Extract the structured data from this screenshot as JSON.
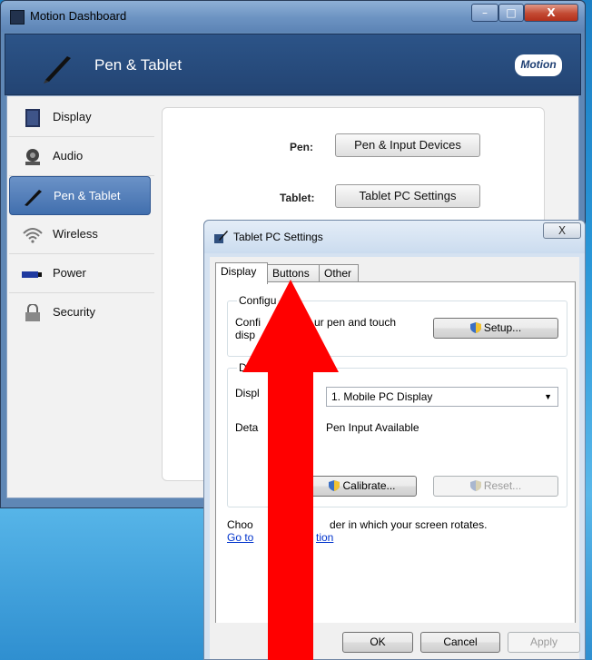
{
  "dashboard": {
    "window_title": "Motion Dashboard",
    "header_title": "Pen & Tablet",
    "logo_text": "Motion",
    "window_buttons": {
      "minimize": "–",
      "maximize": "□",
      "close": "X"
    },
    "nav": [
      {
        "label": "Display",
        "icon": "monitor-icon",
        "active": false
      },
      {
        "label": "Audio",
        "icon": "speaker-icon",
        "active": false
      },
      {
        "label": "Pen & Tablet",
        "icon": "pen-icon",
        "active": true
      },
      {
        "label": "Wireless",
        "icon": "wifi-icon",
        "active": false
      },
      {
        "label": "Power",
        "icon": "battery-icon",
        "active": false
      },
      {
        "label": "Security",
        "icon": "lock-icon",
        "active": false
      }
    ],
    "pen_label": "Pen:",
    "pen_button": "Pen & Input Devices",
    "tablet_label": "Tablet:",
    "tablet_button": "Tablet PC Settings"
  },
  "dialog": {
    "title": "Tablet PC Settings",
    "close_label": "X",
    "tabs": [
      {
        "label": "Display",
        "active": true
      },
      {
        "label": "Buttons",
        "active": false
      },
      {
        "label": "Other",
        "active": false
      }
    ],
    "config_group_title": "Configu",
    "config_text_line1": "Confi",
    "config_text_line1b": "ur pen and touch",
    "config_text_line2": "disp",
    "setup_button": "Setup...",
    "display_group_title": "D",
    "display_label": "Displ",
    "display_select_value": "1. Mobile PC Display",
    "details_label": "Deta",
    "details_value": "Pen Input Available",
    "calibrate_button": "Calibrate...",
    "reset_button": "Reset...",
    "orientation_text_a": "Choo",
    "orientation_text_b": "der in which your screen rotates.",
    "goto_link_a": "Go to",
    "goto_link_b": "tion",
    "ok_button": "OK",
    "cancel_button": "Cancel",
    "apply_button": "Apply"
  },
  "colors": {
    "arrow": "#ff0000",
    "active_nav": "#416fae",
    "link": "#0033cc"
  }
}
